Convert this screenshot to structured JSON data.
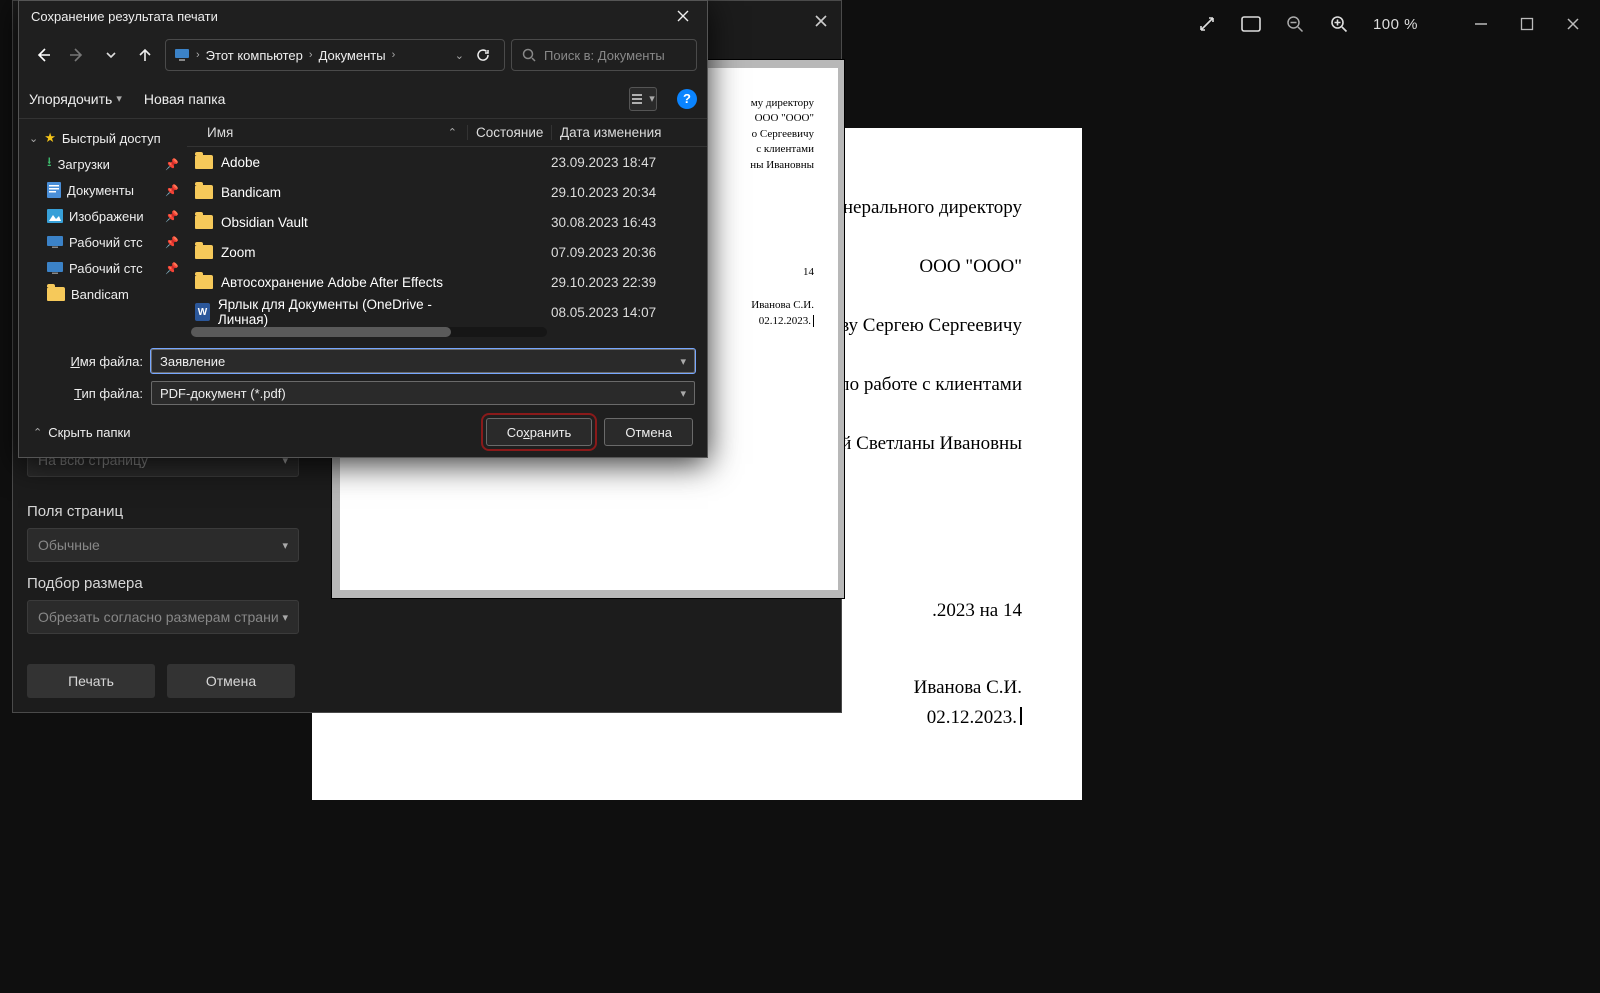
{
  "titlebar": {
    "zoom": "100 %"
  },
  "document": {
    "header_lines": [
      "нерального директору",
      "ООО \"ООО\"",
      "еву Сергею Сергеевичу",
      "по работе с клиентами",
      "ой Светланы Ивановны"
    ],
    "mid_line": ".2023 на 14",
    "sig_name": "Иванова С.И.",
    "sig_date": "02.12.2023."
  },
  "print_panel": {
    "fullpage": "На всю страницу",
    "margins_label": "Поля страниц",
    "margins_value": "Обычные",
    "fit_label": "Подбор размера",
    "fit_value": "Обрезать согласно размерам страни",
    "print_btn": "Печать",
    "cancel_btn": "Отмена",
    "preview": {
      "hdr": [
        "му директору",
        "ООО \"ООО\"",
        "о Сергеевичу",
        "с клиентами",
        "ны Ивановны"
      ],
      "mid": "14",
      "sig_name": "Иванова С.И.",
      "sig_date": "02.12.2023."
    }
  },
  "save_dialog": {
    "title": "Сохранение результата печати",
    "crumb1": "Этот компьютер",
    "crumb2": "Документы",
    "search_placeholder": "Поиск в: Документы",
    "organize": "Упорядочить",
    "new_folder": "Новая папка",
    "help": "?",
    "sidebar": {
      "quick": "Быстрый доступ",
      "items": [
        {
          "label": "Загрузки"
        },
        {
          "label": "Документы"
        },
        {
          "label": "Изображени"
        },
        {
          "label": "Рабочий стс"
        },
        {
          "label": "Рабочий стс"
        },
        {
          "label": "Bandicam"
        }
      ]
    },
    "columns": {
      "name": "Имя",
      "state": "Состояние",
      "date": "Дата изменения"
    },
    "rows": [
      {
        "name": "Adobe",
        "date": "23.09.2023 18:47",
        "type": "folder"
      },
      {
        "name": "Bandicam",
        "date": "29.10.2023 20:34",
        "type": "folder"
      },
      {
        "name": "Obsidian Vault",
        "date": "30.08.2023 16:43",
        "type": "folder"
      },
      {
        "name": "Zoom",
        "date": "07.09.2023 20:36",
        "type": "folder"
      },
      {
        "name": "Автосохранение Adobe After Effects",
        "date": "29.10.2023 22:39",
        "type": "folder"
      },
      {
        "name": "Ярлык для Документы (OneDrive - Личная)",
        "date": "08.05.2023 14:07",
        "type": "word"
      }
    ],
    "filename_label": "Имя файла:",
    "filename_value": "Заявление",
    "filetype_label": "Тип файла:",
    "filetype_value": "PDF-документ (*.pdf)",
    "hide_folders": "Скрыть папки",
    "save_btn": "Сохранить",
    "cancel_btn": "Отмена"
  }
}
